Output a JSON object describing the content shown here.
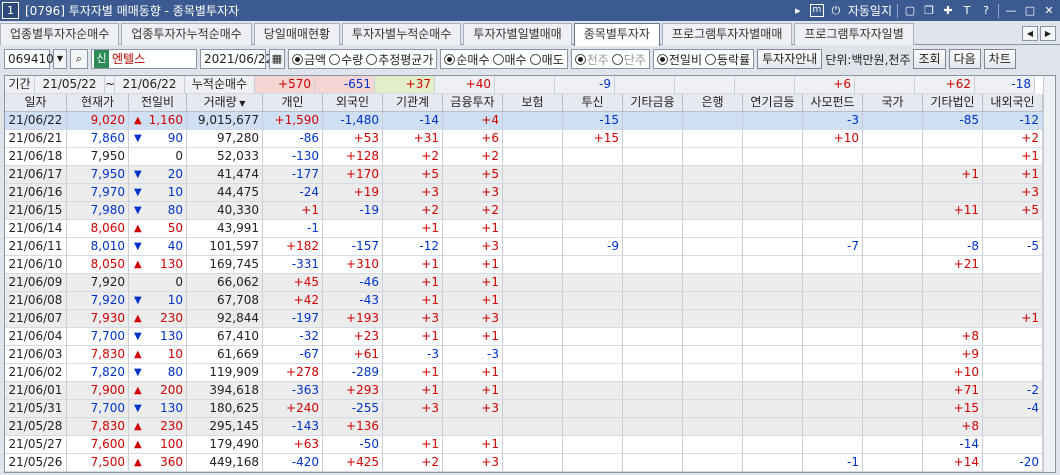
{
  "window": {
    "number_badge": "1",
    "title": "[0796] 투자자별 매매동향 - 종목별투자자",
    "auto_save_label": "자동일지",
    "tool_icons": [
      "menu-icon",
      "m-box-icon",
      "alarm-icon",
      "window-icon",
      "copy-icon",
      "pin-icon",
      "font-icon",
      "help-icon",
      "minimize-icon",
      "maximize-icon",
      "close-icon"
    ]
  },
  "tabs": [
    {
      "label": "업종별투자자순매수",
      "active": false
    },
    {
      "label": "업종투자자누적순매수",
      "active": false
    },
    {
      "label": "당일매매현황",
      "active": false
    },
    {
      "label": "투자자별누적순매수",
      "active": false
    },
    {
      "label": "투자자별일별매매",
      "active": false
    },
    {
      "label": "종목별투자자",
      "active": true
    },
    {
      "label": "프로그램투자자별매매",
      "active": false
    },
    {
      "label": "프로그램투자자일별",
      "active": false
    }
  ],
  "toolbar": {
    "stock_code": "069410",
    "new_badge": "신",
    "stock_name": "엔텔스",
    "date": "2021/06/22",
    "value_options": [
      {
        "label": "금액",
        "checked": true
      },
      {
        "label": "수량",
        "checked": false
      },
      {
        "label": "추정평균가",
        "checked": false
      }
    ],
    "trade_options": [
      {
        "label": "순매수",
        "checked": true
      },
      {
        "label": "매수",
        "checked": false
      },
      {
        "label": "매도",
        "checked": false
      }
    ],
    "unit_options": [
      {
        "label": "천주",
        "checked": true,
        "disabled": true
      },
      {
        "label": "단주",
        "checked": false,
        "disabled": true
      }
    ],
    "compare_options": [
      {
        "label": "전일비",
        "checked": true
      },
      {
        "label": "등락률",
        "checked": false
      }
    ],
    "guide_button": "투자자안내",
    "unit_label": "단위:백만원,천주",
    "search_button": "조회",
    "next_button": "다음",
    "chart_button": "차트"
  },
  "period": {
    "label": "기간",
    "start": "21/05/22",
    "tilde": "~",
    "end": "21/06/22",
    "cumulative_label": "누적순매수",
    "sums": [
      "+570",
      "-651",
      "+37",
      "+40",
      "",
      "-9",
      "",
      "",
      "",
      "+6",
      "",
      "+62",
      "-18"
    ]
  },
  "table": {
    "headers": [
      "일자",
      "현재가",
      "전일비",
      "거래량",
      "개인",
      "외국인",
      "기관계",
      "금융투자",
      "보험",
      "투신",
      "기타금융",
      "은행",
      "연기금등",
      "사모펀드",
      "국가",
      "기타법인",
      "내외국인"
    ],
    "rows": [
      {
        "date": "21/06/22",
        "price": "9,020",
        "dir": "up",
        "change": "1,160",
        "volume": "9,015,677",
        "vals": [
          "+1,590",
          "-1,480",
          "-14",
          "+4",
          "",
          "-15",
          "",
          "",
          "",
          "-3",
          "",
          "-85",
          "-12"
        ]
      },
      {
        "date": "21/06/21",
        "price": "7,860",
        "dir": "dn",
        "change": "90",
        "volume": "97,280",
        "vals": [
          "-86",
          "+53",
          "+31",
          "+6",
          "",
          "+15",
          "",
          "",
          "",
          "+10",
          "",
          "",
          "+2"
        ]
      },
      {
        "date": "21/06/18",
        "price": "7,950",
        "dir": "zero",
        "change": "0",
        "volume": "52,033",
        "vals": [
          "-130",
          "+128",
          "+2",
          "+2",
          "",
          "",
          "",
          "",
          "",
          "",
          "",
          "",
          "+1"
        ]
      },
      {
        "date": "21/06/17",
        "price": "7,950",
        "dir": "dn",
        "change": "20",
        "volume": "41,474",
        "vals": [
          "-177",
          "+170",
          "+5",
          "+5",
          "",
          "",
          "",
          "",
          "",
          "",
          "",
          "+1",
          "+1"
        ]
      },
      {
        "date": "21/06/16",
        "price": "7,970",
        "dir": "dn",
        "change": "10",
        "volume": "44,475",
        "vals": [
          "-24",
          "+19",
          "+3",
          "+3",
          "",
          "",
          "",
          "",
          "",
          "",
          "",
          "",
          "+3"
        ]
      },
      {
        "date": "21/06/15",
        "price": "7,980",
        "dir": "dn",
        "change": "80",
        "volume": "40,330",
        "vals": [
          "+1",
          "-19",
          "+2",
          "+2",
          "",
          "",
          "",
          "",
          "",
          "",
          "",
          "+11",
          "+5"
        ]
      },
      {
        "date": "21/06/14",
        "price": "8,060",
        "dir": "up",
        "change": "50",
        "volume": "43,991",
        "vals": [
          "-1",
          "",
          "+1",
          "+1",
          "",
          "",
          "",
          "",
          "",
          "",
          "",
          "",
          ""
        ]
      },
      {
        "date": "21/06/11",
        "price": "8,010",
        "dir": "dn",
        "change": "40",
        "volume": "101,597",
        "vals": [
          "+182",
          "-157",
          "-12",
          "+3",
          "",
          "-9",
          "",
          "",
          "",
          "-7",
          "",
          "-8",
          "-5"
        ]
      },
      {
        "date": "21/06/10",
        "price": "8,050",
        "dir": "up",
        "change": "130",
        "volume": "169,745",
        "vals": [
          "-331",
          "+310",
          "+1",
          "+1",
          "",
          "",
          "",
          "",
          "",
          "",
          "",
          "+21",
          ""
        ]
      },
      {
        "date": "21/06/09",
        "price": "7,920",
        "dir": "zero",
        "change": "0",
        "volume": "66,062",
        "vals": [
          "+45",
          "-46",
          "+1",
          "+1",
          "",
          "",
          "",
          "",
          "",
          "",
          "",
          "",
          ""
        ]
      },
      {
        "date": "21/06/08",
        "price": "7,920",
        "dir": "dn",
        "change": "10",
        "volume": "67,708",
        "vals": [
          "+42",
          "-43",
          "+1",
          "+1",
          "",
          "",
          "",
          "",
          "",
          "",
          "",
          "",
          ""
        ]
      },
      {
        "date": "21/06/07",
        "price": "7,930",
        "dir": "up",
        "change": "230",
        "volume": "92,844",
        "vals": [
          "-197",
          "+193",
          "+3",
          "+3",
          "",
          "",
          "",
          "",
          "",
          "",
          "",
          "",
          "+1"
        ]
      },
      {
        "date": "21/06/04",
        "price": "7,700",
        "dir": "dn",
        "change": "130",
        "volume": "67,410",
        "vals": [
          "-32",
          "+23",
          "+1",
          "+1",
          "",
          "",
          "",
          "",
          "",
          "",
          "",
          "+8",
          ""
        ]
      },
      {
        "date": "21/06/03",
        "price": "7,830",
        "dir": "up",
        "change": "10",
        "volume": "61,669",
        "vals": [
          "-67",
          "+61",
          "-3",
          "-3",
          "",
          "",
          "",
          "",
          "",
          "",
          "",
          "+9",
          ""
        ]
      },
      {
        "date": "21/06/02",
        "price": "7,820",
        "dir": "dn",
        "change": "80",
        "volume": "119,909",
        "vals": [
          "+278",
          "-289",
          "+1",
          "+1",
          "",
          "",
          "",
          "",
          "",
          "",
          "",
          "+10",
          ""
        ]
      },
      {
        "date": "21/06/01",
        "price": "7,900",
        "dir": "up",
        "change": "200",
        "volume": "394,618",
        "vals": [
          "-363",
          "+293",
          "+1",
          "+1",
          "",
          "",
          "",
          "",
          "",
          "",
          "",
          "+71",
          "-2"
        ]
      },
      {
        "date": "21/05/31",
        "price": "7,700",
        "dir": "dn",
        "change": "130",
        "volume": "180,625",
        "vals": [
          "+240",
          "-255",
          "+3",
          "+3",
          "",
          "",
          "",
          "",
          "",
          "",
          "",
          "+15",
          "-4"
        ]
      },
      {
        "date": "21/05/28",
        "price": "7,830",
        "dir": "up",
        "change": "230",
        "volume": "295,145",
        "vals": [
          "-143",
          "+136",
          "",
          "",
          "",
          "",
          "",
          "",
          "",
          "",
          "",
          "+8",
          ""
        ]
      },
      {
        "date": "21/05/27",
        "price": "7,600",
        "dir": "up",
        "change": "100",
        "volume": "179,490",
        "vals": [
          "+63",
          "-50",
          "+1",
          "+1",
          "",
          "",
          "",
          "",
          "",
          "",
          "",
          "-14",
          ""
        ]
      },
      {
        "date": "21/05/26",
        "price": "7,500",
        "dir": "up",
        "change": "360",
        "volume": "449,168",
        "vals": [
          "-420",
          "+425",
          "+2",
          "+3",
          "",
          "",
          "",
          "",
          "",
          "-1",
          "",
          "+14",
          "-20"
        ]
      }
    ]
  }
}
